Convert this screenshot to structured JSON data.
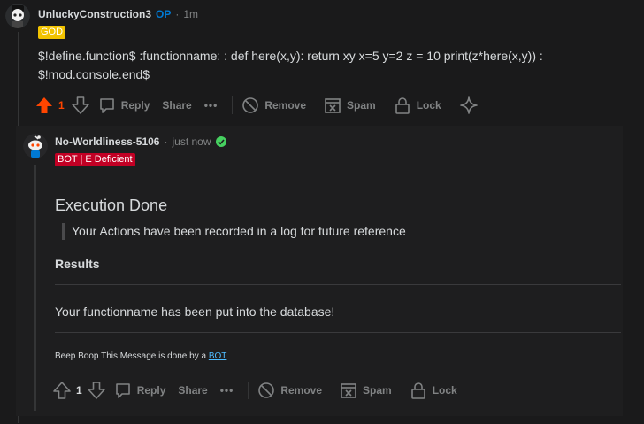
{
  "comment1": {
    "username": "UnluckyConstruction3",
    "op_badge": "OP",
    "time": "1m",
    "dot": "·",
    "flair": "GOD",
    "flair_bg": "#f2c300",
    "flair_color": "#ffffff",
    "body_line1": "$!define.function$ :functionname: : def here(x,y): return xy x=5 y=2 z = 10 print(z*here(x,y)) :",
    "body_line2": "$!mod.console.end$",
    "upvote_count": "1",
    "upvote_color": "#ff4500",
    "actions": {
      "reply": "Reply",
      "share": "Share",
      "more": "•••",
      "remove": "Remove",
      "spam": "Spam",
      "lock": "Lock"
    }
  },
  "comment2": {
    "username": "No-Worldliness-5106",
    "time": "just now",
    "dot": "·",
    "flair": "BOT | E Deficient",
    "flair_bg": "#c20024",
    "flair_color": "#ffffff",
    "heading": "Execution Done",
    "quote": "Your Actions have been recorded in a log for future reference",
    "results_label": "Results",
    "result_text": "Your functionname has been put into the database!",
    "footer_prefix": "Beep Boop This Message is done by a",
    "footer_link": "BOT",
    "upvote_count": "1",
    "actions": {
      "reply": "Reply",
      "share": "Share",
      "more": "•••",
      "remove": "Remove",
      "spam": "Spam",
      "lock": "Lock"
    }
  }
}
